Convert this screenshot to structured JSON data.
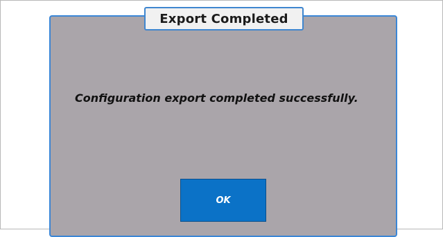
{
  "dialog": {
    "title": "Export Completed",
    "message": "Configuration export completed successfully.",
    "ok_label": "OK"
  },
  "colors": {
    "dialog_background": "#aaa5aa",
    "dialog_border": "#3a86d6",
    "title_background": "#f1f1f1",
    "button_background": "#0b72c7",
    "button_text": "#ffffff"
  }
}
